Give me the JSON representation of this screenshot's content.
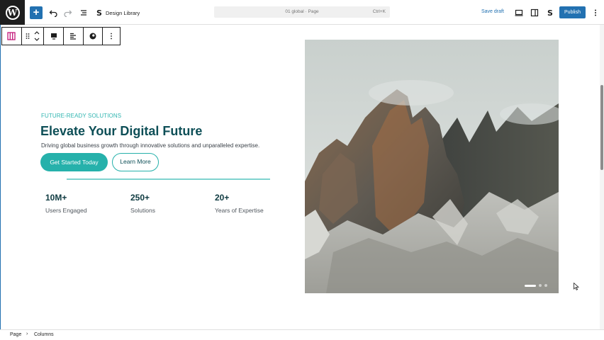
{
  "topbar": {
    "design_library_label": "Design Library",
    "command_title": "01 global · Page",
    "command_shortcut": "Ctrl+K",
    "save_draft_label": "Save draft",
    "publish_label": "Publish"
  },
  "hero": {
    "eyebrow": "FUTURE-READY SOLUTIONS",
    "heading": "Elevate Your Digital Future",
    "description": "Driving global business growth through innovative solutions and unparalleled expertise.",
    "primary_button": "Get Started Today",
    "secondary_button": "Learn More"
  },
  "stats": [
    {
      "value": "10M+",
      "label": "Users Engaged"
    },
    {
      "value": "250+",
      "label": "Solutions"
    },
    {
      "value": "20+",
      "label": "Years of Expertise"
    }
  ],
  "breadcrumb": {
    "page": "Page",
    "separator": "›",
    "current": "Columns"
  },
  "colors": {
    "accent": "#26b1ab",
    "heading": "#0e4f57",
    "wp_blue": "#2271b1"
  }
}
